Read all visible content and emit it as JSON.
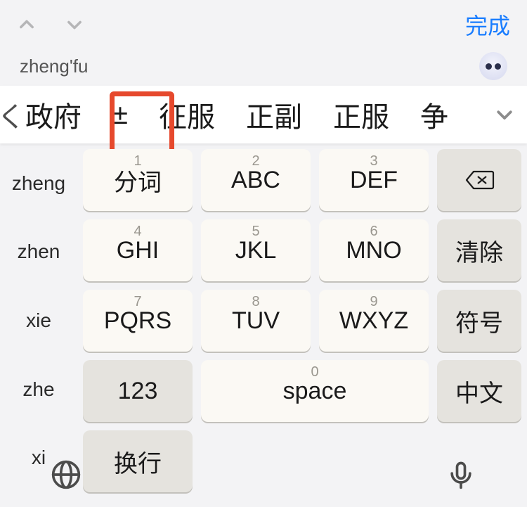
{
  "topbar": {
    "done_label": "完成"
  },
  "compose": {
    "text": "zheng'fu"
  },
  "candidates": [
    "政府",
    "±",
    "征服",
    "正副",
    "正服",
    "争"
  ],
  "sidebar_syllables": [
    "zheng",
    "zhen",
    "xie",
    "zhe",
    "xi"
  ],
  "keys": {
    "row1": [
      {
        "digit": "1",
        "label": "分词"
      },
      {
        "digit": "2",
        "label": "ABC"
      },
      {
        "digit": "3",
        "label": "DEF"
      }
    ],
    "row2": [
      {
        "digit": "4",
        "label": "GHI"
      },
      {
        "digit": "5",
        "label": "JKL"
      },
      {
        "digit": "6",
        "label": "MNO"
      }
    ],
    "row3": [
      {
        "digit": "7",
        "label": "PQRS"
      },
      {
        "digit": "8",
        "label": "TUV"
      },
      {
        "digit": "9",
        "label": "WXYZ"
      }
    ],
    "mode123": "123",
    "space_digit": "0",
    "space_label": "space",
    "zhongwen": "中文",
    "side": {
      "clear": "清除",
      "symbol": "符号",
      "enter": "换行"
    }
  }
}
